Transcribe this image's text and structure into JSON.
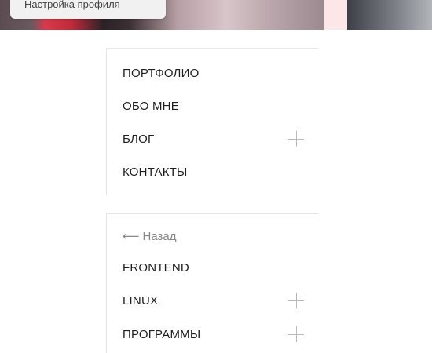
{
  "hero": {
    "caption": "Настройка профиля"
  },
  "menu_main": {
    "items": [
      {
        "label": "ПОРТФОЛИО",
        "has_submenu": false
      },
      {
        "label": "ОБО МНЕ",
        "has_submenu": false
      },
      {
        "label": "БЛОГ",
        "has_submenu": true,
        "icon": "plus-icon"
      },
      {
        "label": "КОНТАКТЫ",
        "has_submenu": false
      }
    ]
  },
  "menu_blog": {
    "back_label": "Назад",
    "back_icon": "arrow-left-icon",
    "items": [
      {
        "label": "FRONTEND",
        "has_submenu": false
      },
      {
        "label": "LINUX",
        "has_submenu": true,
        "icon": "plus-icon"
      },
      {
        "label": "ПРОГРАММЫ",
        "has_submenu": true,
        "icon": "plus-icon"
      }
    ]
  },
  "colors": {
    "text": "#1f1f1f",
    "muted": "#8a8a8a",
    "divider": "#e4e4e4",
    "icon": "#b9b9b9"
  }
}
